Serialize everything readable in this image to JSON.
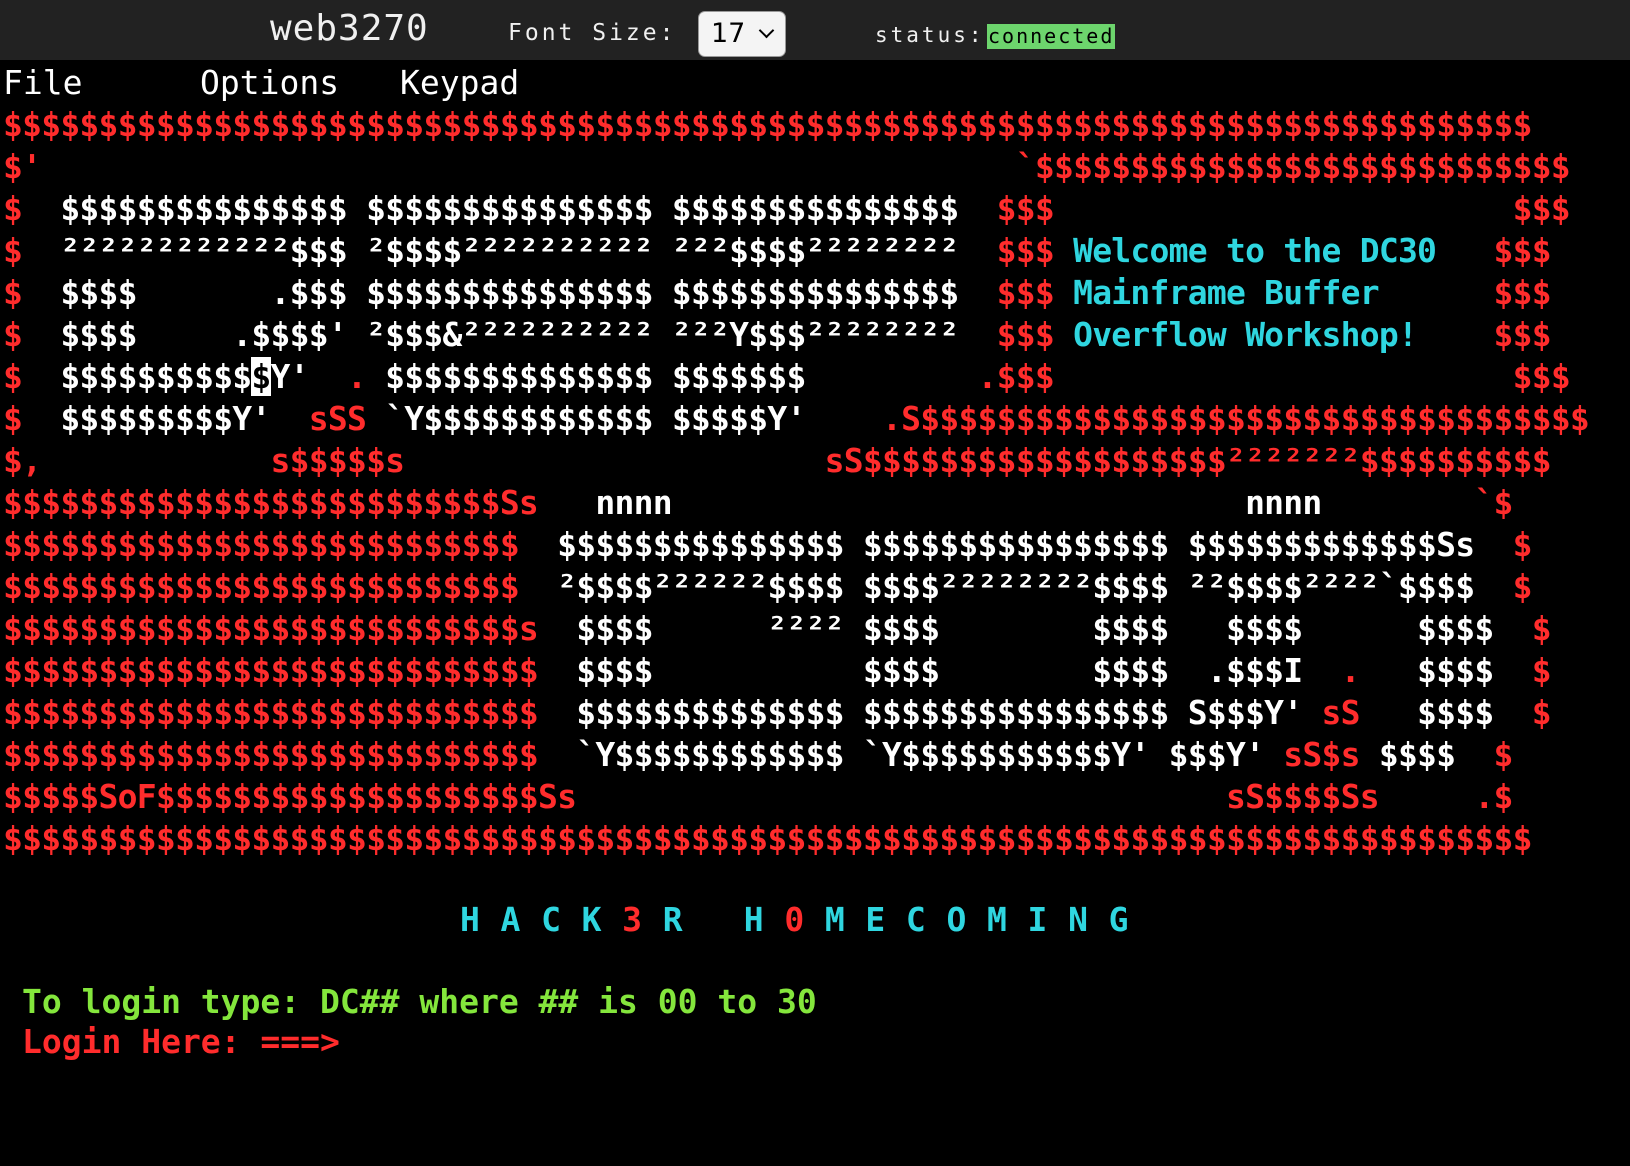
{
  "header": {
    "app_title": "web3270",
    "font_size_label": "Font Size:",
    "font_size_value": "17",
    "status_label": "status:",
    "status_value": "connected"
  },
  "menu": [
    "File",
    "Options",
    "Keypad"
  ],
  "colors": {
    "red": "#ff2c2c",
    "white": "#ffffff",
    "cyan": "#2fd6e0",
    "green": "#84e63c",
    "status_badge": "#6dd56d",
    "topbar": "#222222"
  },
  "screen": {
    "rows": [
      [
        [
          "r",
          "$$$$$$$$$$$$$$$$$$$$$$$$$$$$$$$$$$$$$$$$$$$$$$$$$$$$$$$$$$$$$$$$$$$$$$$$$$$$$$$$"
        ]
      ],
      [
        [
          "r",
          "$'                                                   `$$$$$$$$$$$$$$$$$$$$$$$$$$$$"
        ]
      ],
      [
        [
          "r",
          "$  "
        ],
        [
          "w",
          "$$$$$$$$$$$$$$$ $$$$$$$$$$$$$$$ $$$$$$$$$$$$$$$  "
        ],
        [
          "r",
          "$$$                        $$$"
        ]
      ],
      [
        [
          "r",
          "$  "
        ],
        [
          "w",
          "²²²²²²²²²²²²$$$ ²$$$$²²²²²²²²²² ²²²$$$$²²²²²²²²  "
        ],
        [
          "r",
          "$$$ "
        ],
        [
          "c",
          "Welcome to the DC30   "
        ],
        [
          "r",
          "$$$"
        ]
      ],
      [
        [
          "r",
          "$  "
        ],
        [
          "w",
          "$$$$       .$$$ $$$$$$$$$$$$$$$ $$$$$$$$$$$$$$$  "
        ],
        [
          "r",
          "$$$ "
        ],
        [
          "c",
          "Mainframe Buffer      "
        ],
        [
          "r",
          "$$$"
        ]
      ],
      [
        [
          "r",
          "$  "
        ],
        [
          "w",
          "$$$$     .$$$$' ²$$$&²²²²²²²²²² ²²²Y$$$²²²²²²²²  "
        ],
        [
          "r",
          "$$$ "
        ],
        [
          "c",
          "Overflow Workshop!    "
        ],
        [
          "r",
          "$$$"
        ]
      ],
      [
        [
          "r",
          "$  "
        ],
        [
          "w",
          "$$$$$$$$$$"
        ],
        [
          "cur",
          "$"
        ],
        [
          "w",
          "Y'  "
        ],
        [
          "r",
          "."
        ],
        [
          "w",
          " $$$$$$$$$$$$$$ $$$$$$$       "
        ],
        [
          "r",
          "  .$$$                        $$$"
        ]
      ],
      [
        [
          "r",
          "$  "
        ],
        [
          "w",
          "$$$$$$$$$Y'  "
        ],
        [
          "r",
          "sSS"
        ],
        [
          "w",
          " `Y$$$$$$$$$$$$ $$$$$Y'  "
        ],
        [
          "r",
          "  .S$$$$$$$$$$$$$$$$$$$$$$$$$$$$$$$$$$$"
        ]
      ],
      [
        [
          "r",
          "$,            s$$$$$s                      sS$$$$$$$$$$$$$$$$$$$²²²²²²²$$$$$$$$$$"
        ]
      ],
      [
        [
          "r",
          "$$$$$$$$$$$$$$$$$$$$$$$$$$Ss"
        ],
        [
          "w",
          "   nnnn                              nnnn        "
        ],
        [
          "r",
          "`$"
        ]
      ],
      [
        [
          "r",
          "$$$$$$$$$$$$$$$$$$$$$$$$$$$"
        ],
        [
          "w",
          "  $$$$$$$$$$$$$$$ $$$$$$$$$$$$$$$$ $$$$$$$$$$$$$Ss  "
        ],
        [
          "r",
          "$"
        ]
      ],
      [
        [
          "r",
          "$$$$$$$$$$$$$$$$$$$$$$$$$$$"
        ],
        [
          "w",
          "  ²$$$$²²²²²²$$$$ $$$$²²²²²²²²$$$$ ²²$$$$²²²²`$$$$  "
        ],
        [
          "r",
          "$"
        ]
      ],
      [
        [
          "r",
          "$$$$$$$$$$$$$$$$$$$$$$$$$$$s"
        ],
        [
          "w",
          "  $$$$      ²²²² $$$$        $$$$   $$$$      $$$$  "
        ],
        [
          "r",
          "$"
        ]
      ],
      [
        [
          "r",
          "$$$$$$$$$$$$$$$$$$$$$$$$$$$$"
        ],
        [
          "w",
          "  $$$$           $$$$        $$$$  .$$$I  "
        ],
        [
          "r",
          "."
        ],
        [
          "w",
          "   $$$$  "
        ],
        [
          "r",
          "$"
        ]
      ],
      [
        [
          "r",
          "$$$$$$$$$$$$$$$$$$$$$$$$$$$$"
        ],
        [
          "w",
          "  $$$$$$$$$$$$$$ $$$$$$$$$$$$$$$$ S$$$Y' "
        ],
        [
          "r",
          "sS"
        ],
        [
          "w",
          "   $$$$  "
        ],
        [
          "r",
          "$"
        ]
      ],
      [
        [
          "r",
          "$$$$$$$$$$$$$$$$$$$$$$$$$$$$"
        ],
        [
          "w",
          "  `Y$$$$$$$$$$$$ `Y$$$$$$$$$$$Y' $$$Y' "
        ],
        [
          "r",
          "sS$s"
        ],
        [
          "w",
          " $$$$  "
        ],
        [
          "r",
          "$"
        ]
      ],
      [
        [
          "r",
          "$$$$$SoF$$$$$$$$$$$$$$$$$$$$Ss                                  sS$$$$Ss     .$"
        ]
      ],
      [
        [
          "r",
          "$$$$$$$$$$$$$$$$$$$$$$$$$$$$$$$$$$$$$$$$$$$$$$$$$$$$$$$$$$$$$$$$$$$$$$$$$$$$$$$$"
        ]
      ]
    ]
  },
  "banner": {
    "part1": "H A C K ",
    "hl1": "3",
    "part2": " R   H ",
    "hl2": "0",
    "part3": " M E C O M I N G"
  },
  "login": {
    "hint": "To login type: DC## where ## is 00 to 30",
    "prompt": "Login Here: ===>",
    "input_value": ""
  }
}
